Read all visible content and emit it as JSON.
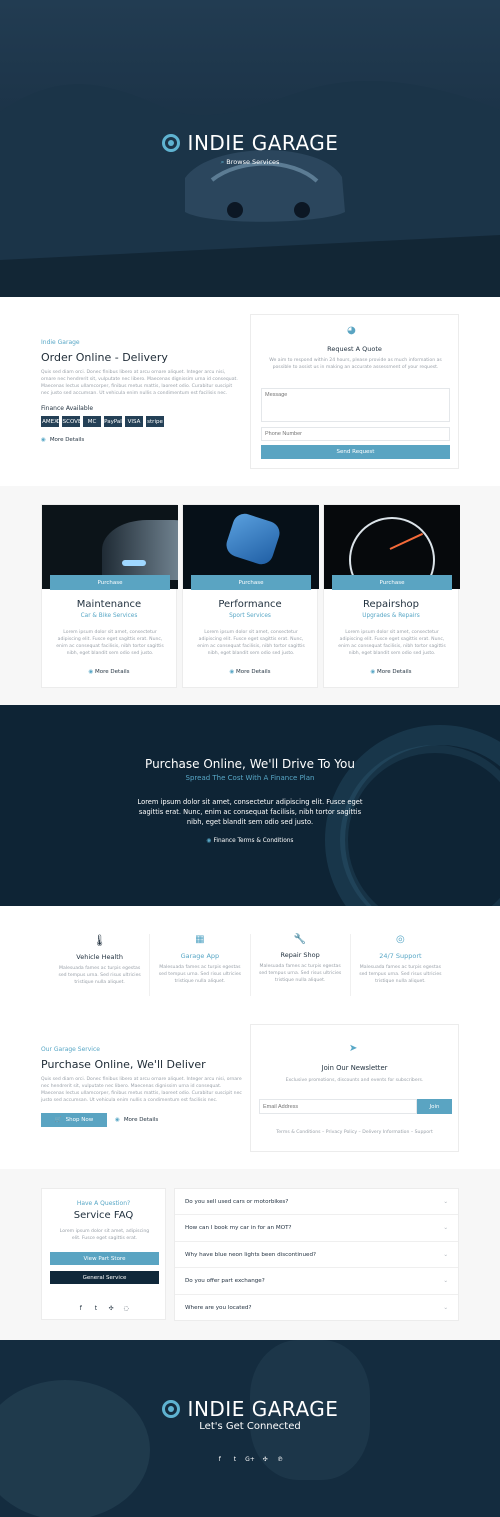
{
  "hero": {
    "brand": "INDIE GARAGE",
    "browse": "Browse Services"
  },
  "order": {
    "kicker": "Indie Garage",
    "title": "Order Online - Delivery",
    "body": "Quis sed diam orci. Donec finibus libero at arcu ornare aliquet. Integer arcu nisi, ornare nec hendrerit sit, vulputate nec libero. Maecenas dignissim urna id consequat. Maecenas lectus ullamcorper, finibus metus mattis, laoreet odio. Curabitur suscipit nec justo sed accumsan. Ut vehicula enim nullis a condimentum est facilisis nec.",
    "finance_label": "Finance Available",
    "more": "More Details",
    "payment": [
      "AMEX",
      "DISCOVER",
      "MC",
      "PayPal",
      "VISA",
      "stripe"
    ]
  },
  "quote": {
    "title": "Request A Quote",
    "body": "We aim to respond within 24 hours, please provide as much information as possible to assist us in making an accurate assessment of your request.",
    "message_placeholder": "Message",
    "phone_placeholder": "Phone Number",
    "send": "Send Request"
  },
  "services": [
    {
      "badge": "Purchase",
      "title": "Maintenance",
      "subtitle": "Car & Bike Services",
      "body": "Lorem ipsum dolor sit amet, consectetur adipiscing elit. Fusce eget sagittis erat. Nunc, enim ac consequat facilisis, nibh tortor sagittis nibh, eget blandit sem odio sed justo.",
      "more": "More Details"
    },
    {
      "badge": "Purchase",
      "title": "Performance",
      "subtitle": "Sport Services",
      "body": "Lorem ipsum dolor sit amet, consectetur adipiscing elit. Fusce eget sagittis erat. Nunc, enim ac consequat facilisis, nibh tortor sagittis nibh, eget blandit sem odio sed justo.",
      "more": "More Details"
    },
    {
      "badge": "Purchase",
      "title": "Repairshop",
      "subtitle": "Upgrades & Repairs",
      "body": "Lorem ipsum dolor sit amet, consectetur adipiscing elit. Fusce eget sagittis erat. Nunc, enim ac consequat facilisis, nibh tortor sagittis nibh, eget blandit sem odio sed justo.",
      "more": "More Details"
    }
  ],
  "banner": {
    "title": "Purchase Online, We'll Drive To You",
    "subtitle": "Spread The Cost With A Finance Plan",
    "body": "Lorem ipsum dolor sit amet, consectetur adipiscing elit. Fusce eget sagittis erat. Nunc, enim ac consequat facilisis, nibh tortor sagittis nibh, eget blandit sem odio sed justo.",
    "link": "Finance Terms & Conditions"
  },
  "features": [
    {
      "icon": "thermometer-icon",
      "title": "Vehicle Health",
      "body": "Malesuada fames ac turpis egestas sed tempus urna. Sed risus ultricies tristique nulla aliquet."
    },
    {
      "icon": "qr-icon",
      "title": "Garage App",
      "body": "Malesuada fames ac turpis egestas sed tempus urna. Sed risus ultricies tristique nulla aliquet."
    },
    {
      "icon": "wrench-icon",
      "title": "Repair Shop",
      "body": "Malesuada fames ac turpis egestas sed tempus urna. Sed risus ultricies tristique nulla aliquet."
    },
    {
      "icon": "whatsapp-icon",
      "title": "24/7 Support",
      "body": "Malesuada fames ac turpis egestas sed tempus urna. Sed risus ultricies tristique nulla aliquet."
    }
  ],
  "delivery": {
    "kicker": "Our Garage Service",
    "title": "Purchase Online, We'll Deliver",
    "body": "Quis sed diam orci. Donec finibus libero at arcu ornare aliquet. Integer arcu nisi, ornare nec hendrerit sit, vulputate nec libero. Maecenas dignissim urna id consequat. Maecenas lectus ullamcorper, finibus metus mattis, laoreet odio. Curabitur suscipit nec justo sed accumsan. Ut vehicula enim nullis a condimentum est facilisis nec.",
    "shop": "Shop Now",
    "more": "More Details"
  },
  "newsletter": {
    "title": "Join Our Newsletter",
    "body": "Exclusive promotions, discounts and events for subscribers.",
    "email_placeholder": "Email Address",
    "join": "Join",
    "links": "Terms & Conditions – Privacy Policy – Delivery Information – Support"
  },
  "faq": {
    "kicker": "Have A Question?",
    "title": "Service FAQ",
    "body": "Lorem ipsum dolor sit amet, adipiscing elit. Fusce eget sagittis erat.",
    "primary": "View Part Store",
    "secondary": "General Service",
    "items": [
      "Do you sell used cars or motorbikes?",
      "How can I book my car in for an MOT?",
      "Why have blue neon lights been discontinued?",
      "Do you offer part exchange?",
      "Where are you located?"
    ]
  },
  "footer": {
    "brand": "INDIE GARAGE",
    "tagline": "Let's Get Connected"
  },
  "colors": {
    "accent": "#5aa4c2",
    "dark": "#10283a"
  }
}
